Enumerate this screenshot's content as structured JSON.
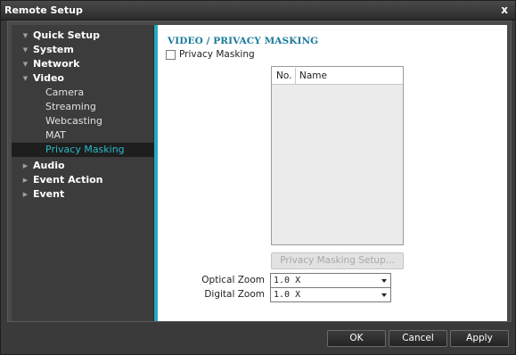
{
  "window": {
    "title": "Remote Setup",
    "close_label": "x"
  },
  "sidebar": {
    "items": [
      {
        "label": "Quick Setup",
        "level": 0,
        "expanded": true
      },
      {
        "label": "System",
        "level": 0,
        "expanded": true
      },
      {
        "label": "Network",
        "level": 0,
        "expanded": true
      },
      {
        "label": "Video",
        "level": 0,
        "expanded": true
      },
      {
        "label": "Camera",
        "level": 1
      },
      {
        "label": "Streaming",
        "level": 1
      },
      {
        "label": "Webcasting",
        "level": 1
      },
      {
        "label": "MAT",
        "level": 1
      },
      {
        "label": "Privacy Masking",
        "level": 1,
        "selected": true
      },
      {
        "label": "Audio",
        "level": 0,
        "expanded": false
      },
      {
        "label": "Event Action",
        "level": 0,
        "expanded": false
      },
      {
        "label": "Event",
        "level": 0,
        "expanded": false
      }
    ]
  },
  "main": {
    "title": "VIDEO / PRIVACY MASKING",
    "privacy_masking_checkbox": {
      "label": "Privacy Masking",
      "checked": false
    },
    "list": {
      "columns": [
        "No.",
        "Name"
      ],
      "rows": []
    },
    "setup_button": {
      "label": "Privacy Masking Setup...",
      "enabled": false
    },
    "optical_zoom": {
      "label": "Optical Zoom",
      "value": "1.0 X"
    },
    "digital_zoom": {
      "label": "Digital Zoom",
      "value": "1.0 X"
    }
  },
  "footer": {
    "ok_label": "OK",
    "cancel_label": "Cancel",
    "apply_label": "Apply"
  },
  "colors": {
    "accent": "#26a8bf",
    "title_text": "#1a7a9a",
    "selected_text": "#2bb8c8",
    "background": "#3a3a3a"
  }
}
